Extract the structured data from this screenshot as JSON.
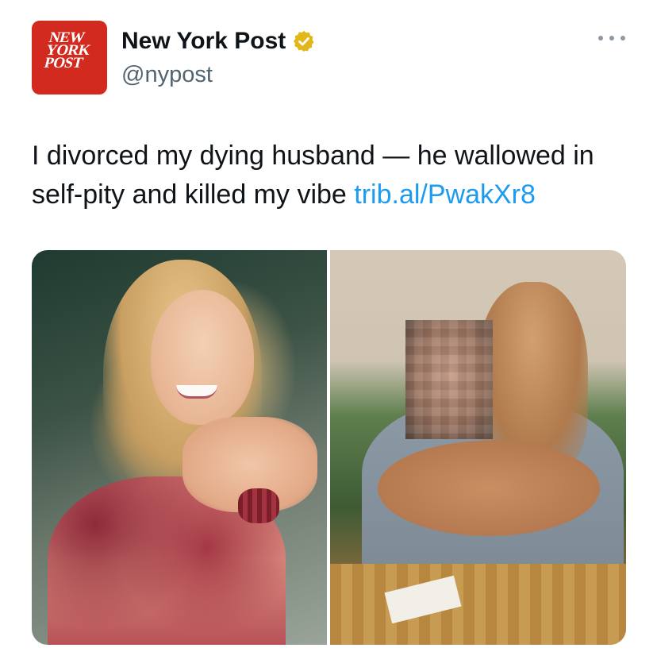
{
  "tweet": {
    "author": {
      "display_name": "New York Post",
      "handle": "@nypost",
      "verified": true,
      "verified_badge_color": "#e2b719",
      "avatar": {
        "logo_lines": [
          "NEW",
          "YORK",
          "POST"
        ],
        "background": "#d32a1f"
      }
    },
    "more_icon": "more-horizontal-icon",
    "text": "I divorced my dying husband — he wallowed in self-pity and killed my vibe ",
    "link": {
      "label": "trib.al/PwakXr8",
      "color": "#1d9bf0"
    },
    "media": {
      "count": 2,
      "images": [
        "photo-left",
        "photo-right"
      ]
    }
  }
}
